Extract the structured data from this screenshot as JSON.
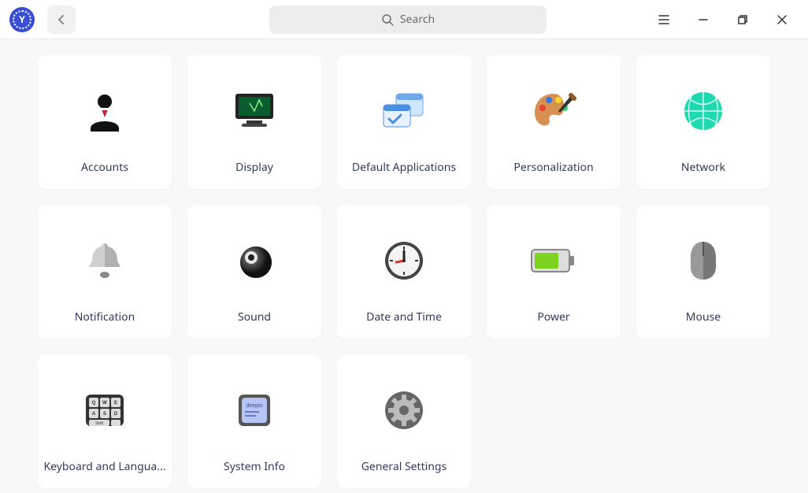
{
  "header": {
    "search_placeholder": "Search"
  },
  "categories": [
    {
      "id": "accounts",
      "label": "Accounts",
      "icon": "accounts-icon"
    },
    {
      "id": "display",
      "label": "Display",
      "icon": "display-icon"
    },
    {
      "id": "default-apps",
      "label": "Default Applications",
      "icon": "default-apps-icon"
    },
    {
      "id": "personalization",
      "label": "Personalization",
      "icon": "personalization-icon"
    },
    {
      "id": "network",
      "label": "Network",
      "icon": "network-icon"
    },
    {
      "id": "notification",
      "label": "Notification",
      "icon": "notification-icon"
    },
    {
      "id": "sound",
      "label": "Sound",
      "icon": "sound-icon"
    },
    {
      "id": "datetime",
      "label": "Date and Time",
      "icon": "clock-icon"
    },
    {
      "id": "power",
      "label": "Power",
      "icon": "battery-icon"
    },
    {
      "id": "mouse",
      "label": "Mouse",
      "icon": "mouse-icon"
    },
    {
      "id": "keyboard",
      "label": "Keyboard and Langua...",
      "icon": "keyboard-icon"
    },
    {
      "id": "sysinfo",
      "label": "System Info",
      "icon": "sysinfo-icon"
    },
    {
      "id": "general",
      "label": "General Settings",
      "icon": "gear-icon"
    }
  ]
}
